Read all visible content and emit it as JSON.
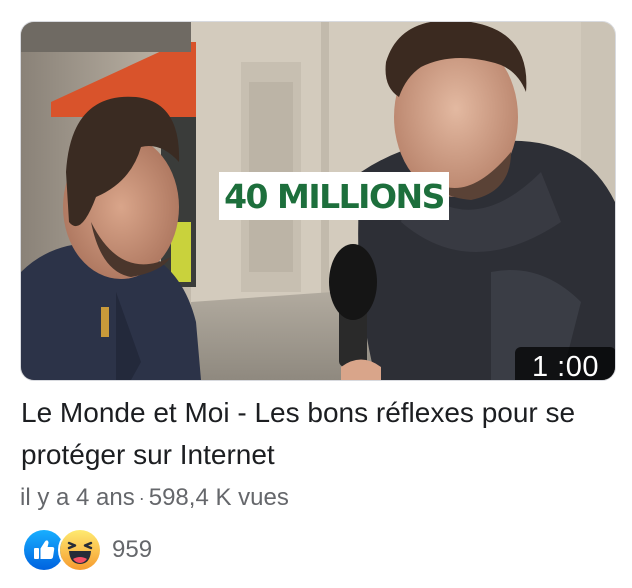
{
  "video": {
    "overlay_text": "40 MILLIONS",
    "duration": "1 :00",
    "title": "Le Monde et Moi - Les bons réflexes pour se protéger sur Internet",
    "age": "il y a 4 ans",
    "separator": "·",
    "views": "598,4 K vues"
  },
  "reactions": {
    "icons": [
      "like-icon",
      "haha-icon"
    ],
    "count": "959"
  },
  "colors": {
    "overlay_text": "#1d6f3c",
    "like": "#1877f2",
    "haha": "#f7b125",
    "meta_text": "#65676b"
  }
}
